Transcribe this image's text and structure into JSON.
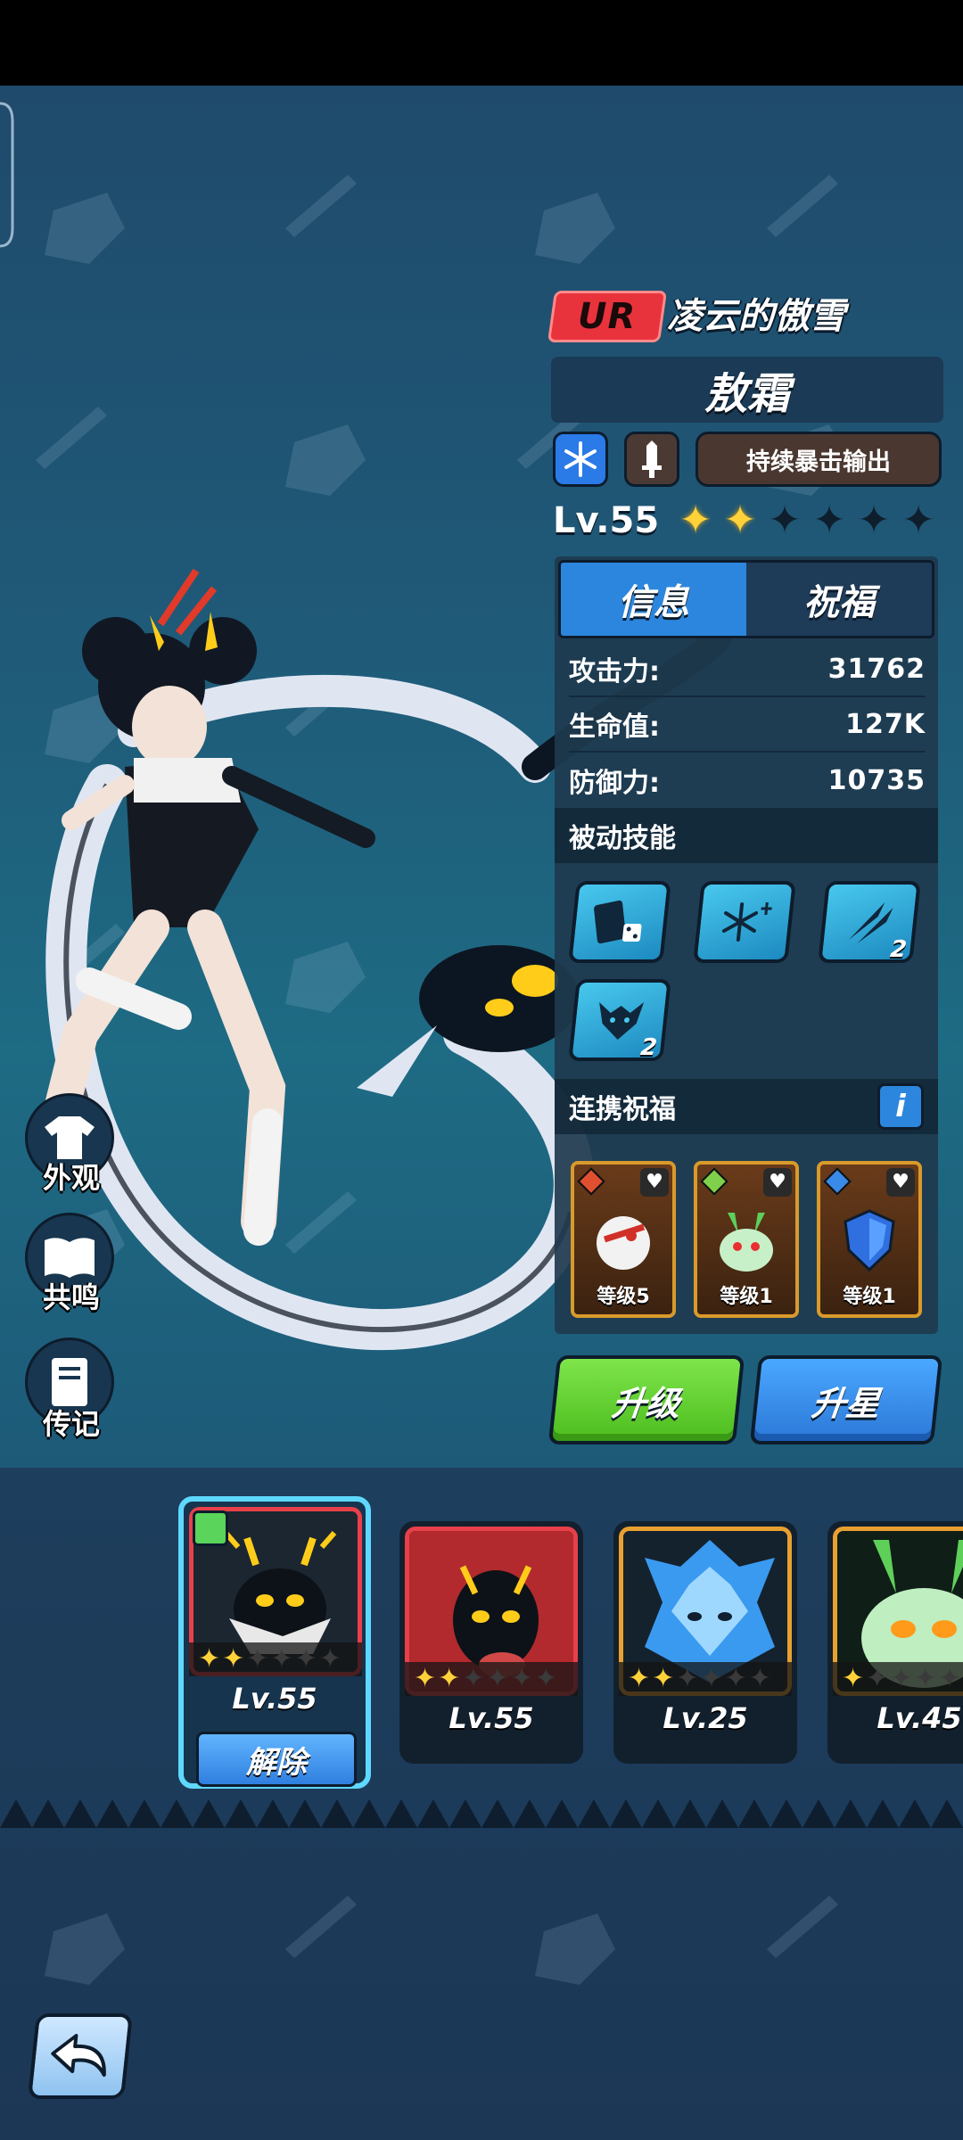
{
  "hero": {
    "rarity": "UR",
    "subtitle": "凌云的傲雪",
    "name": "敖霜",
    "element_icon": "snowflake-icon",
    "weapon_icon": "sword-icon",
    "role_tag": "持续暴击输出",
    "level_label": "Lv.55",
    "stars_filled": 2,
    "stars_total": 6
  },
  "tabs": [
    {
      "label": "信息",
      "active": true
    },
    {
      "label": "祝福",
      "active": false
    }
  ],
  "stats": [
    {
      "label": "攻击力:",
      "value": "31762"
    },
    {
      "label": "生命值:",
      "value": "127K"
    },
    {
      "label": "防御力:",
      "value": "10735"
    }
  ],
  "passive": {
    "title": "被动技能",
    "skills": [
      {
        "icon": "cards-dice-icon",
        "level": ""
      },
      {
        "icon": "snowflakes-icon",
        "level": ""
      },
      {
        "icon": "claw-slash-icon",
        "level": "2"
      },
      {
        "icon": "dragon-head-icon",
        "level": "2"
      }
    ]
  },
  "bond": {
    "title": "连携祝福",
    "info_label": "i",
    "cards": [
      {
        "icon": "white-bird-icon",
        "label": "等级5"
      },
      {
        "icon": "green-spirit-icon",
        "label": "等级1"
      },
      {
        "icon": "blue-shield-icon",
        "label": "等级1"
      }
    ]
  },
  "actions": {
    "upgrade": "升级",
    "star_up": "升星"
  },
  "side_menu": [
    {
      "icon": "shirt-icon",
      "label": "外观"
    },
    {
      "icon": "book-icon",
      "label": "共鸣"
    },
    {
      "icon": "journal-icon",
      "label": "传记"
    }
  ],
  "pets": [
    {
      "level": "Lv.55",
      "stars": 2,
      "frame": "#e8404a",
      "selected": true
    },
    {
      "level": "Lv.55",
      "stars": 2,
      "frame": "#e8404a",
      "selected": false
    },
    {
      "level": "Lv.25",
      "stars": 2,
      "frame": "#e8a030",
      "selected": false
    },
    {
      "level": "Lv.45",
      "stars": 1,
      "frame": "#e8a030",
      "selected": false
    }
  ],
  "remove_label": "解除",
  "colors": {
    "accent_blue": "#2c86dd",
    "accent_green": "#62d232",
    "ur_red": "#e8333d",
    "star_gold": "#ffd23a"
  }
}
